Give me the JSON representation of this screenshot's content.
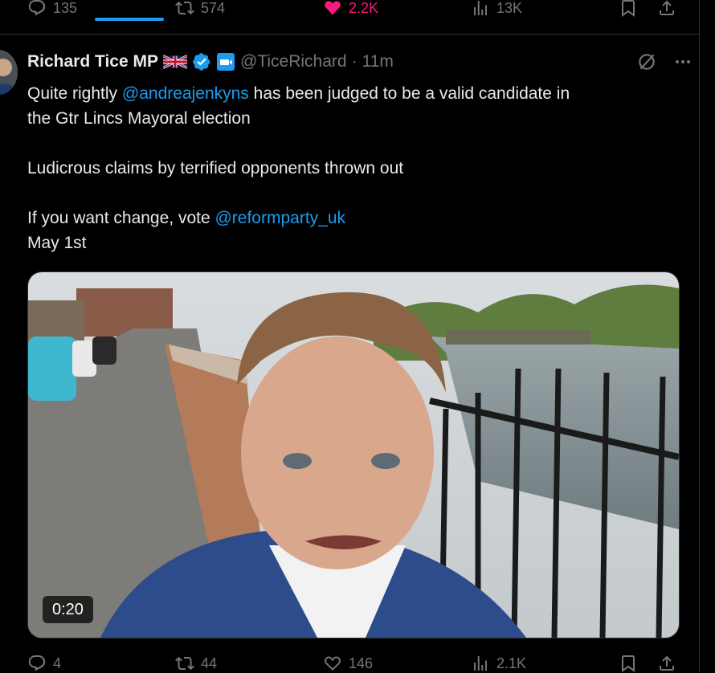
{
  "previous_post": {
    "replies": "135",
    "reposts": "574",
    "likes": "2.2K",
    "views": "13K",
    "like_color": "#f91880"
  },
  "post": {
    "author_name": "Richard Tice MP",
    "handle": "@TiceRichard",
    "separator": "·",
    "time": "11m",
    "text_lines": [
      {
        "before": "Quite rightly ",
        "mention": "@andreajenkyns",
        "after": " has been judged to be a valid candidate in"
      },
      {
        "plain": "the Gtr Lincs Mayoral election"
      },
      {
        "plain": "Ludicrous claims by terrified opponents thrown out"
      },
      {
        "before": "If you want change, vote ",
        "mention": "@reformparty_uk"
      },
      {
        "plain": "May 1st"
      }
    ],
    "video_duration": "0:20",
    "actions": {
      "replies": "4",
      "reposts": "44",
      "likes": "146",
      "views": "2.1K"
    },
    "icons": {
      "flag": "uk-flag-icon",
      "verified": "verified-badge-icon",
      "affiliate": "affiliate-badge-icon",
      "grok": "grok-icon",
      "more": "more-icon"
    }
  },
  "colors": {
    "background": "#000000",
    "text": "#e7e9ea",
    "muted": "#71767b",
    "accent": "#1d9bf0",
    "border": "#2f3336"
  }
}
